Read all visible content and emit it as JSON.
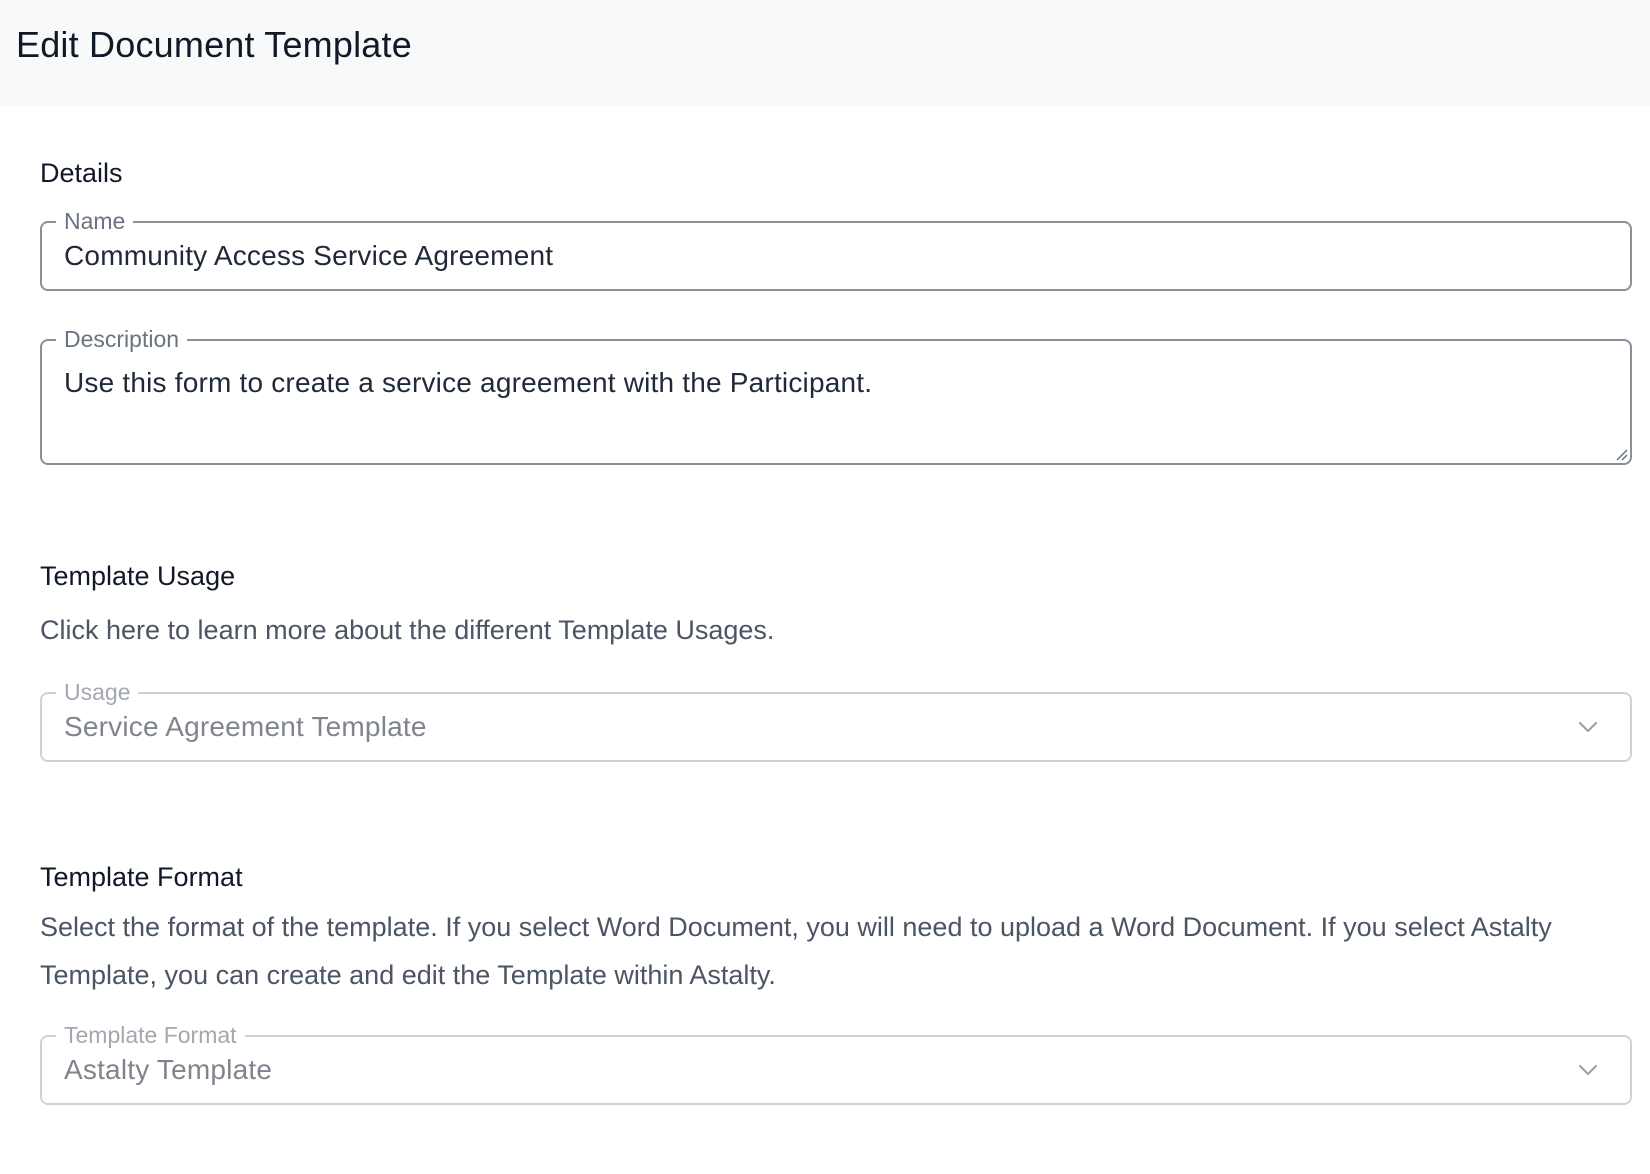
{
  "page": {
    "title": "Edit Document Template"
  },
  "details": {
    "heading": "Details",
    "name_label": "Name",
    "name_value": "Community Access Service Agreement",
    "description_label": "Description",
    "description_value": "Use this form to create a service agreement with the Participant."
  },
  "usage": {
    "heading": "Template Usage",
    "help_text": "Click here to learn more about the different Template Usages.",
    "usage_label": "Usage",
    "usage_value": "Service Agreement Template",
    "disabled": true
  },
  "format": {
    "heading": "Template Format",
    "help_text": "Select the format of the template. If you select Word Document, you will need to upload a Word Document. If you select Astalty Template, you can create and edit the Template within Astalty.",
    "format_label": "Template Format",
    "format_value": "Astalty Template",
    "disabled": true
  },
  "icons": {
    "usage_dropdown": "chevron-down-icon",
    "format_dropdown": "chevron-down-icon",
    "description_resize": "resize-handle-icon"
  },
  "colors": {
    "header_bg": "#f8f9fb",
    "border_active": "#8a909a",
    "border_disabled": "#cfd3d9",
    "text_primary": "#111827",
    "text_muted": "#4b5563"
  }
}
